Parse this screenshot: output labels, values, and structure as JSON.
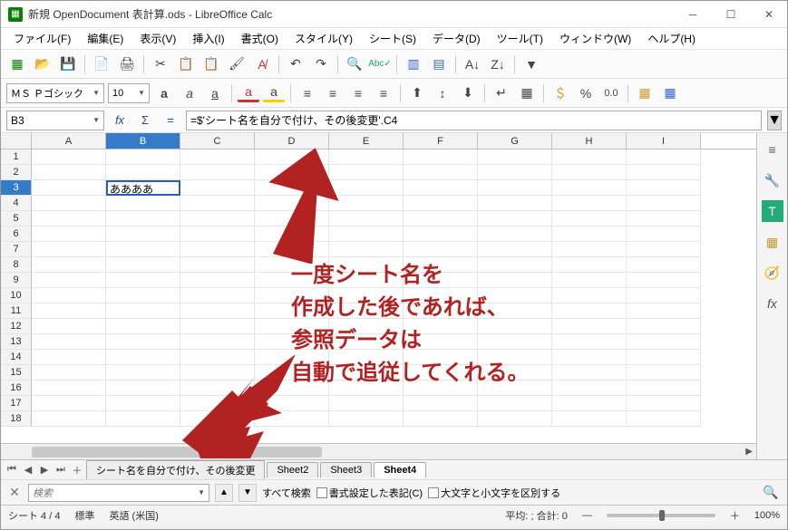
{
  "window": {
    "title": "新規 OpenDocument 表計算.ods - LibreOffice Calc"
  },
  "menu": {
    "file": "ファイル(F)",
    "edit": "編集(E)",
    "view": "表示(V)",
    "insert": "挿入(I)",
    "format": "書式(O)",
    "style": "スタイル(Y)",
    "sheet": "シート(S)",
    "data": "データ(D)",
    "tools": "ツール(T)",
    "window": "ウィンドウ(W)",
    "help": "ヘルプ(H)"
  },
  "font": {
    "name": "ＭＳ Ｐゴシック",
    "size": "10"
  },
  "namebox": "B3",
  "formula": "=$'シート名を自分で付け、その後変更'.C4",
  "columns": [
    "A",
    "B",
    "C",
    "D",
    "E",
    "F",
    "G",
    "H",
    "I"
  ],
  "rows": [
    "1",
    "2",
    "3",
    "4",
    "5",
    "6",
    "7",
    "8",
    "9",
    "10",
    "11",
    "12",
    "13",
    "14",
    "15",
    "16",
    "17",
    "18"
  ],
  "cells": {
    "B3": "ああああ"
  },
  "tabs": {
    "t1": "シート名を自分で付け、その後変更",
    "t2": "Sheet2",
    "t3": "Sheet3",
    "t4": "Sheet4"
  },
  "find": {
    "placeholder": "検索",
    "all": "すべて検索",
    "format": "書式設定した表記(C)",
    "case": "大文字と小文字を区別する"
  },
  "status": {
    "sheet": "シート 4 / 4",
    "style": "標準",
    "lang": "英語 (米国)",
    "calc": "平均: ; 合計: 0",
    "zoom": "100%"
  },
  "annotation": {
    "text": "一度シート名を\n作成した後であれば、\n参照データは\n自動で追従してくれる。"
  }
}
